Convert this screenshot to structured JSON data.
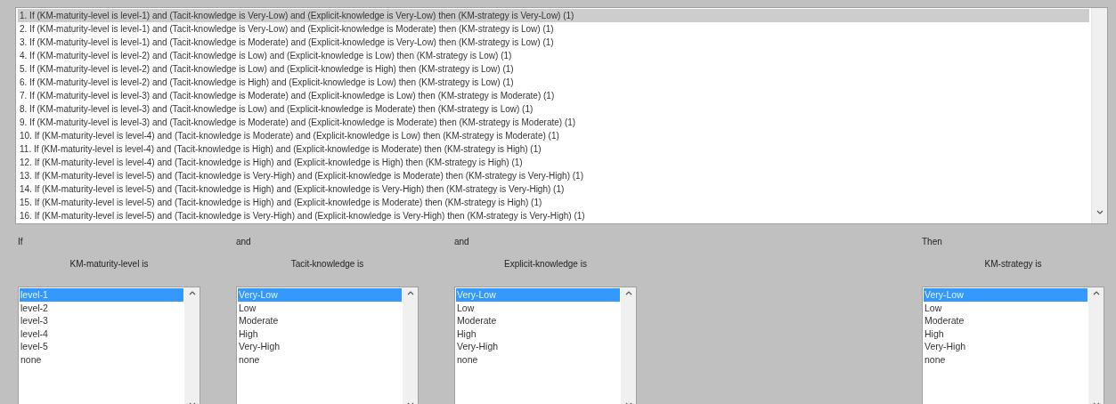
{
  "rules": {
    "items": [
      {
        "text": "1. If (KM-maturity-level is level-1) and (Tacit-knowledge is Very-Low) and (Explicit-knowledge is Very-Low) then (KM-strategy is Very-Low) (1)",
        "selected": true
      },
      {
        "text": "2. If (KM-maturity-level is level-1) and (Tacit-knowledge is Very-Low) and (Explicit-knowledge is Moderate) then (KM-strategy is Low) (1)",
        "selected": false
      },
      {
        "text": "3. If (KM-maturity-level is level-1) and (Tacit-knowledge is Moderate) and (Explicit-knowledge is Very-Low) then (KM-strategy is Low) (1)",
        "selected": false
      },
      {
        "text": "4. If (KM-maturity-level is level-2) and (Tacit-knowledge is Low) and (Explicit-knowledge is Low) then (KM-strategy is Low) (1)",
        "selected": false
      },
      {
        "text": "5. If (KM-maturity-level is level-2) and (Tacit-knowledge is Low) and (Explicit-knowledge is High) then (KM-strategy is Low) (1)",
        "selected": false
      },
      {
        "text": "6. If (KM-maturity-level is level-2) and (Tacit-knowledge is High) and (Explicit-knowledge is Low) then (KM-strategy is Low) (1)",
        "selected": false
      },
      {
        "text": "7. If (KM-maturity-level is level-3) and (Tacit-knowledge is Moderate) and (Explicit-knowledge is Low) then (KM-strategy is Moderate) (1)",
        "selected": false
      },
      {
        "text": "8. If (KM-maturity-level is level-3) and (Tacit-knowledge is Low) and (Explicit-knowledge is Moderate) then (KM-strategy is Low) (1)",
        "selected": false
      },
      {
        "text": "9. If (KM-maturity-level is level-3) and (Tacit-knowledge is Moderate) and (Explicit-knowledge is Moderate) then (KM-strategy is Moderate) (1)",
        "selected": false
      },
      {
        "text": "10. If (KM-maturity-level is level-4) and (Tacit-knowledge is Moderate) and (Explicit-knowledge is Low) then (KM-strategy is Moderate) (1)",
        "selected": false
      },
      {
        "text": "11. If (KM-maturity-level is level-4) and (Tacit-knowledge is High) and (Explicit-knowledge is Moderate) then (KM-strategy is High) (1)",
        "selected": false
      },
      {
        "text": "12. If (KM-maturity-level is level-4) and (Tacit-knowledge is High) and (Explicit-knowledge is High) then (KM-strategy is High) (1)",
        "selected": false
      },
      {
        "text": "13. If (KM-maturity-level is level-5) and (Tacit-knowledge is Very-High) and (Explicit-knowledge is Moderate) then (KM-strategy is Very-High) (1)",
        "selected": false
      },
      {
        "text": "14. If (KM-maturity-level is level-5) and (Tacit-knowledge is High) and (Explicit-knowledge is Very-High) then (KM-strategy is Very-High) (1)",
        "selected": false
      },
      {
        "text": "15. If (KM-maturity-level is level-5) and (Tacit-knowledge is High) and (Explicit-knowledge is Moderate) then (KM-strategy is High) (1)",
        "selected": false
      },
      {
        "text": "16. If (KM-maturity-level is level-5) and (Tacit-knowledge is Very-High) and (Explicit-knowledge is Very-High) then (KM-strategy is Very-High) (1)",
        "selected": false
      }
    ]
  },
  "variables": [
    {
      "kind": "input",
      "connector": "If",
      "label": "KM-maturity-level is",
      "options": [
        {
          "label": "level-1",
          "selected": true
        },
        {
          "label": "level-2",
          "selected": false
        },
        {
          "label": "level-3",
          "selected": false
        },
        {
          "label": "level-4",
          "selected": false
        },
        {
          "label": "level-5",
          "selected": false
        },
        {
          "label": "none",
          "selected": false
        }
      ]
    },
    {
      "kind": "input",
      "connector": "and",
      "label": "Tacit-knowledge is",
      "options": [
        {
          "label": "Very-Low",
          "selected": true
        },
        {
          "label": "Low",
          "selected": false
        },
        {
          "label": "Moderate",
          "selected": false
        },
        {
          "label": "High",
          "selected": false
        },
        {
          "label": "Very-High",
          "selected": false
        },
        {
          "label": "none",
          "selected": false
        }
      ]
    },
    {
      "kind": "input",
      "connector": "and",
      "label": "Explicit-knowledge is",
      "options": [
        {
          "label": "Very-Low",
          "selected": true
        },
        {
          "label": "Low",
          "selected": false
        },
        {
          "label": "Moderate",
          "selected": false
        },
        {
          "label": "High",
          "selected": false
        },
        {
          "label": "Very-High",
          "selected": false
        },
        {
          "label": "none",
          "selected": false
        }
      ]
    },
    {
      "kind": "output",
      "connector": "Then",
      "label": "KM-strategy is",
      "options": [
        {
          "label": "Very-Low",
          "selected": true
        },
        {
          "label": "Low",
          "selected": false
        },
        {
          "label": "Moderate",
          "selected": false
        },
        {
          "label": "High",
          "selected": false
        },
        {
          "label": "Very-High",
          "selected": false
        },
        {
          "label": "none",
          "selected": false
        }
      ]
    }
  ]
}
